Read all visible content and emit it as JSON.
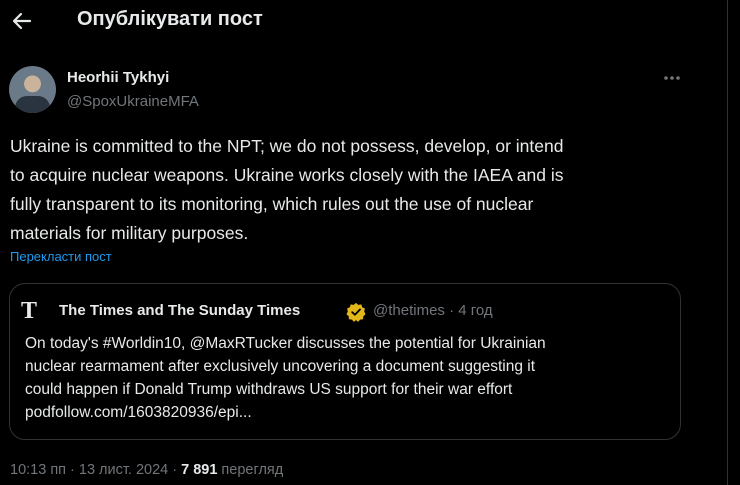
{
  "header": {
    "title": "Опублікувати пост"
  },
  "post": {
    "author_name": "Heorhii Tykhyi",
    "author_handle": "@SpoxUkraineMFA",
    "text": "Ukraine is committed to the NPT; we do not possess, develop, or intend\nto acquire nuclear weapons. Ukraine works closely with the IAEA and is\nfully transparent to its monitoring, which rules out the use of nuclear\nmaterials for military purposes.",
    "translate_label": "Перекласти пост"
  },
  "quote": {
    "logo_letter": "T",
    "name": "The Times and The Sunday Times",
    "handle_time": "@thetimes · 4 год",
    "text": "On today's #Worldin10, @MaxRTucker discusses the potential for Ukrainian\nnuclear rearmament after exclusively uncovering a document suggesting it\ncould happen if Donald Trump withdraws US support for their war effort\npodfollow.com/1603820936/epi..."
  },
  "meta": {
    "time_date": "10:13 пп · 13 лист. 2024 · ",
    "views": "7 891",
    "views_label": " перегляд"
  },
  "colors": {
    "background": "#000000",
    "text": "#e7e9ea",
    "muted": "#71767b",
    "link": "#1d9bf0",
    "verified": "#e2b719"
  }
}
